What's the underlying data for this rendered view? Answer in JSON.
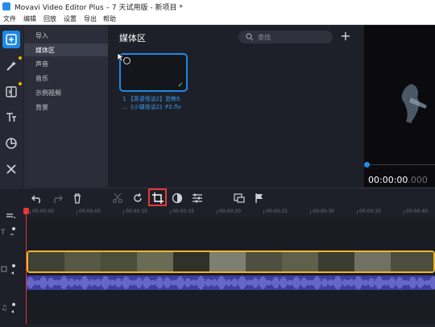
{
  "window": {
    "title": "Movavi Video Editor Plus – 7 天试用版 - 新项目 *"
  },
  "menu": [
    "文件",
    "编辑",
    "回放",
    "设置",
    "导出",
    "帮助"
  ],
  "tools": [
    {
      "name": "import-tool",
      "icon": "import-icon",
      "active": true
    },
    {
      "name": "filters-tool",
      "icon": "magic-wand-icon",
      "dot": true
    },
    {
      "name": "transitions-tool",
      "icon": "transition-icon",
      "dot": true
    },
    {
      "name": "titles-tool",
      "icon": "text-icon"
    },
    {
      "name": "stickers-tool",
      "icon": "sticker-icon"
    },
    {
      "name": "more-tools",
      "icon": "tools-icon"
    }
  ],
  "nav": {
    "items": [
      "导入",
      "媒体区",
      "声音",
      "音乐",
      "示例视频",
      "背景"
    ],
    "selected": 1
  },
  "media": {
    "heading": "媒体区",
    "search_placeholder": "查找",
    "add_label": "+",
    "clip_label_line1": "1 【英语怪谈2】恐怖5",
    "clip_label_line2": "...《小镇怪谈2》P2.flv"
  },
  "preview": {
    "timecode_main": "00:00:00",
    "timecode_ms": ".000"
  },
  "timeline": {
    "ticks": [
      "00:00:00",
      "00:00:05",
      "00:00:10",
      "00:00:15",
      "00:00:20",
      "00:00:25",
      "00:00:30",
      "00:00:35",
      "00:00:40"
    ]
  },
  "colors": {
    "accent": "#1e88e5",
    "highlight": "#e53935",
    "clip_border": "#f0b429",
    "audio": "#3d3fa0"
  }
}
